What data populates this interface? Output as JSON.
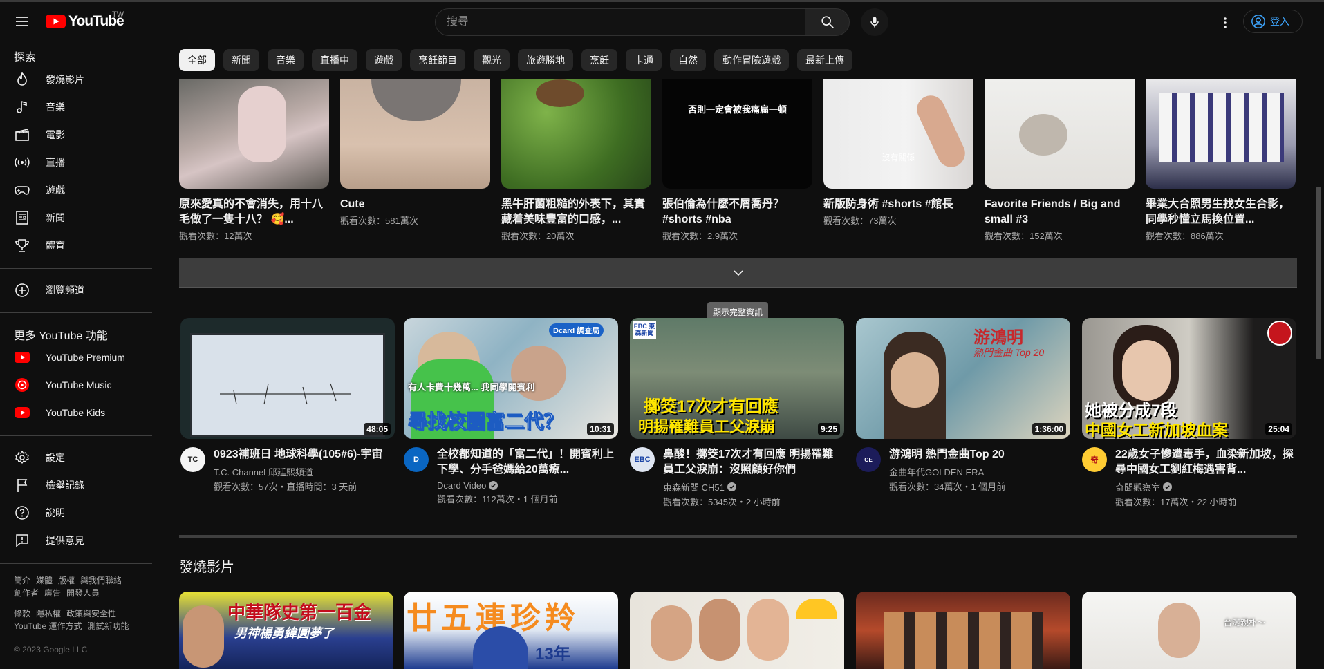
{
  "header": {
    "logo_text": "YouTube",
    "region": "TW",
    "search_placeholder": "搜尋",
    "signin": "登入"
  },
  "sidebar": {
    "explore_title": "探索",
    "explore": [
      {
        "label": "發燒影片",
        "icon": "trending-icon"
      },
      {
        "label": "音樂",
        "icon": "music-icon"
      },
      {
        "label": "電影",
        "icon": "film-icon"
      },
      {
        "label": "直播",
        "icon": "live-icon"
      },
      {
        "label": "遊戲",
        "icon": "gaming-icon"
      },
      {
        "label": "新聞",
        "icon": "news-icon"
      },
      {
        "label": "體育",
        "icon": "trophy-icon"
      }
    ],
    "browse_channels": "瀏覽頻道",
    "more_title": "更多 YouTube 功能",
    "more": [
      {
        "label": "YouTube Premium"
      },
      {
        "label": "YouTube Music"
      },
      {
        "label": "YouTube Kids"
      }
    ],
    "settings": [
      {
        "label": "設定",
        "icon": "gear-icon"
      },
      {
        "label": "檢舉記錄",
        "icon": "flag-icon"
      },
      {
        "label": "說明",
        "icon": "help-icon"
      },
      {
        "label": "提供意見",
        "icon": "feedback-icon"
      }
    ],
    "footer1": [
      "簡介",
      "媒體",
      "版權",
      "與我們聯絡",
      "創作者",
      "廣告",
      "開發人員"
    ],
    "footer2": [
      "條款",
      "隱私權",
      "政策與安全性",
      "YouTube 運作方式",
      "測試新功能"
    ],
    "copyright": "© 2023 Google LLC"
  },
  "chips": [
    "全部",
    "新聞",
    "音樂",
    "直播中",
    "遊戲",
    "烹飪節目",
    "觀光",
    "旅遊勝地",
    "烹飪",
    "卡通",
    "自然",
    "動作冒險遊戲",
    "最新上傳"
  ],
  "shorts": [
    {
      "title": "原來愛真的不會消失，用十八毛做了一隻十八？ 🥰...",
      "views": "觀看次數：12萬次",
      "overlay": ""
    },
    {
      "title": "Cute",
      "views": "觀看次數：581萬次",
      "overlay": ""
    },
    {
      "title": "黑牛肝菌粗糙的外表下，其實藏着美味豐富的口感，...",
      "views": "觀看次數：20萬次",
      "overlay": ""
    },
    {
      "title": "張伯倫為什麼不屑喬丹？ #shorts #nba",
      "views": "觀看次數：2.9萬次",
      "overlay": "否則一定會被我痛扁一頓"
    },
    {
      "title": "新版防身術 #shorts #館長",
      "views": "觀看次數：73萬次",
      "overlay": "沒有關係"
    },
    {
      "title": "Favorite Friends / Big and small #3",
      "views": "觀看次數：152萬次",
      "overlay": ""
    },
    {
      "title": "畢業大合照男生找女生合影，同學秒懂立馬換位置...",
      "views": "觀看次數：886萬次",
      "overlay": ""
    }
  ],
  "expand_tooltip": "顯示完整資訊",
  "videos": [
    {
      "title": "0923補班日 地球科學(105#6)-宇宙",
      "channel": "T.C. Channel 邱廷熙頻道",
      "verified": false,
      "stats": "觀看次數：57次・直播時間：3 天前",
      "duration": "48:05",
      "overlay": ""
    },
    {
      "title": "全校都知道的「富二代」！開賓利上下學、分手爸媽給20萬療...",
      "channel": "Dcard Video",
      "verified": true,
      "stats": "觀看次數：112萬次・1 個月前",
      "duration": "10:31",
      "overlay": "尋找校園富二代？",
      "sub_overlay": "有人卡費十幾萬... 我同學開賓利",
      "badge": "Dcard 調查局"
    },
    {
      "title": "鼻酸！擲筊17次才有回應 明揚罹難員工父淚崩：沒照顧好你們",
      "channel": "東森新聞 CH51",
      "verified": true,
      "stats": "觀看次數：5345次・2 小時前",
      "duration": "9:25",
      "overlay": "擲筊17次才有回應",
      "sub_overlay": "明揚罹難員工父淚崩",
      "badge": "EBC 東森新聞"
    },
    {
      "title": "游鴻明 熱門金曲Top 20",
      "channel": "金曲年代GOLDEN ERA",
      "verified": false,
      "stats": "觀看次數：34萬次・1 個月前",
      "duration": "1:36:00",
      "overlay": "游鴻明",
      "sub_overlay": "熱門金曲 Top 20"
    },
    {
      "title": "22歲女子慘遭毒手，血染新加坡，探尋中國女工劉紅梅遇害背...",
      "channel": "奇聞觀察室",
      "verified": true,
      "stats": "觀看次數：17萬次・22 小時前",
      "duration": "25:04",
      "overlay": "她被分成7段",
      "sub_overlay": "中國女工新加坡血案"
    }
  ],
  "trending_shelf": {
    "title": "發燒影片",
    "thumb_texts": [
      "中華隊史第一百金",
      "男神楊勇緯圓夢了",
      "廿五連珍羚",
      "13年",
      "",
      "",
      "台灣親朴～"
    ]
  },
  "colors": {
    "background": "#0f0f0f",
    "accent": "#ff0000",
    "link": "#3ea6ff"
  }
}
